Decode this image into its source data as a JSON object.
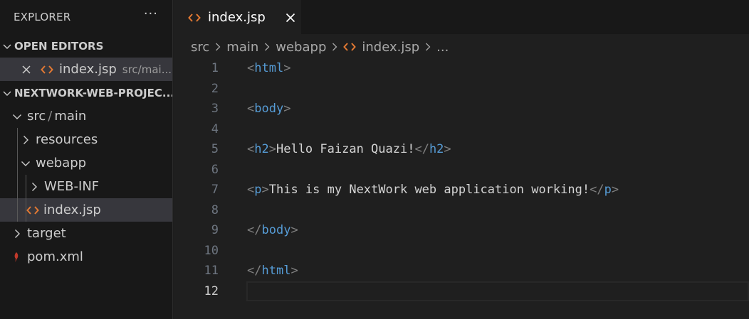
{
  "colors": {
    "tag": "#569cd6",
    "bracket": "#808080",
    "text": "#d4d4d4",
    "jsp_icon": "#e37933",
    "maven_icon": "#c0392b"
  },
  "explorer": {
    "title": "EXPLORER",
    "more_label": "···",
    "open_editors": {
      "title": "OPEN EDITORS",
      "items": [
        {
          "label": "index.jsp",
          "description": "src/mai...",
          "icon": "jsp-file-icon"
        }
      ]
    },
    "project": {
      "title": "NEXTWORK-WEB-PROJEC...",
      "tree": [
        {
          "label_a": "src",
          "label_sep": "/",
          "label_b": "main",
          "expanded": true
        },
        {
          "label": "resources",
          "expanded": false
        },
        {
          "label": "webapp",
          "expanded": true
        },
        {
          "label": "WEB-INF",
          "expanded": false
        },
        {
          "label": "index.jsp",
          "icon": "jsp-file-icon",
          "selected": true
        },
        {
          "label": "target",
          "expanded": false
        },
        {
          "label": "pom.xml",
          "icon": "maven-icon"
        }
      ]
    }
  },
  "editor": {
    "tab": {
      "label": "index.jsp",
      "icon": "jsp-file-icon"
    },
    "breadcrumb": [
      "src",
      "main",
      "webapp",
      "index.jsp",
      "..."
    ],
    "lines": [
      {
        "num": "1",
        "open": "<",
        "tag": "html",
        "close": ">",
        "text": "",
        "open2": "",
        "tag2": "",
        "close2": ""
      },
      {
        "num": "2",
        "open": "",
        "tag": "",
        "close": "",
        "text": "",
        "open2": "",
        "tag2": "",
        "close2": ""
      },
      {
        "num": "3",
        "open": "<",
        "tag": "body",
        "close": ">",
        "text": "",
        "open2": "",
        "tag2": "",
        "close2": ""
      },
      {
        "num": "4",
        "open": "",
        "tag": "",
        "close": "",
        "text": "",
        "open2": "",
        "tag2": "",
        "close2": ""
      },
      {
        "num": "5",
        "open": "<",
        "tag": "h2",
        "close": ">",
        "text": "Hello Faizan Quazi!",
        "open2": "</",
        "tag2": "h2",
        "close2": ">"
      },
      {
        "num": "6",
        "open": "",
        "tag": "",
        "close": "",
        "text": "",
        "open2": "",
        "tag2": "",
        "close2": ""
      },
      {
        "num": "7",
        "open": "<",
        "tag": "p",
        "close": ">",
        "text": "This is my NextWork web application working!",
        "open2": "</",
        "tag2": "p",
        "close2": ">"
      },
      {
        "num": "8",
        "open": "",
        "tag": "",
        "close": "",
        "text": "",
        "open2": "",
        "tag2": "",
        "close2": ""
      },
      {
        "num": "9",
        "open": "</",
        "tag": "body",
        "close": ">",
        "text": "",
        "open2": "",
        "tag2": "",
        "close2": ""
      },
      {
        "num": "10",
        "open": "",
        "tag": "",
        "close": "",
        "text": "",
        "open2": "",
        "tag2": "",
        "close2": ""
      },
      {
        "num": "11",
        "open": "</",
        "tag": "html",
        "close": ">",
        "text": "",
        "open2": "",
        "tag2": "",
        "close2": ""
      },
      {
        "num": "12",
        "open": "",
        "tag": "",
        "close": "",
        "text": "",
        "open2": "",
        "tag2": "",
        "close2": ""
      }
    ],
    "active_line": "12"
  }
}
